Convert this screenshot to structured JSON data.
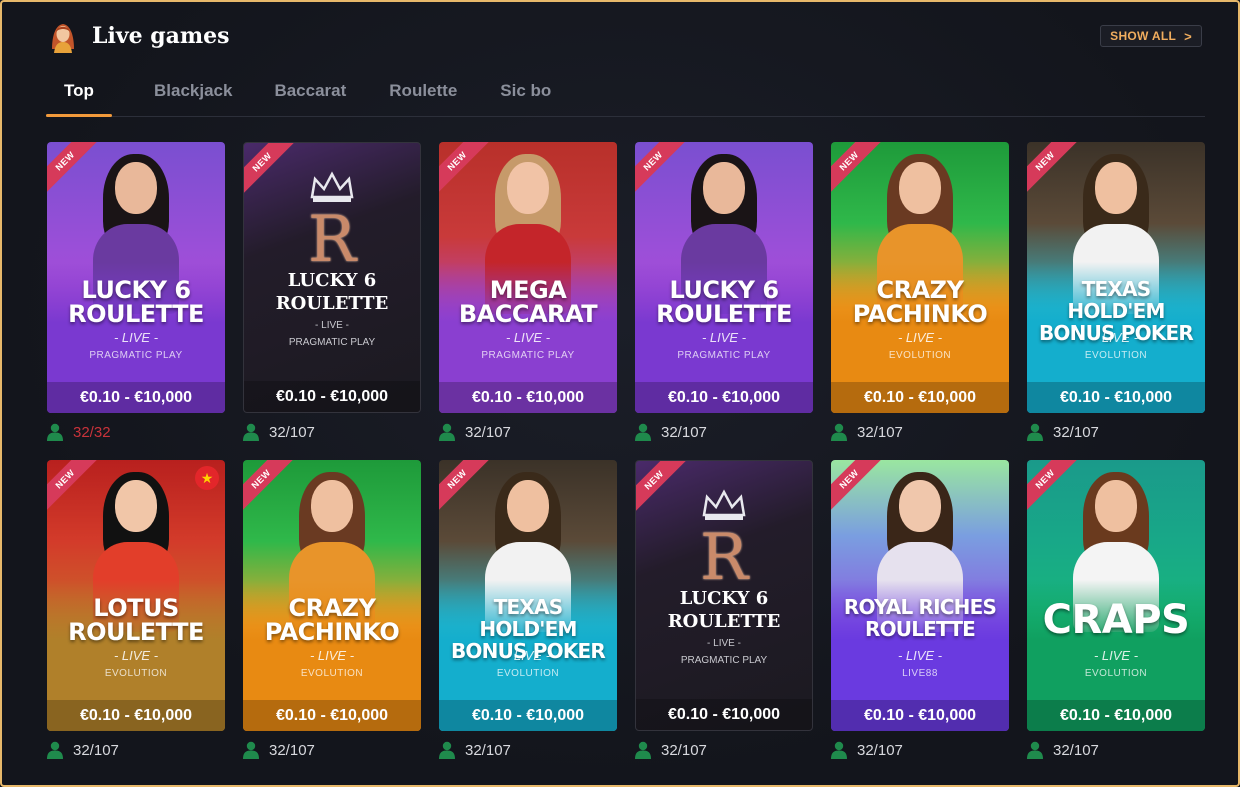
{
  "header": {
    "title": "Live games",
    "show_all_label": "SHOW ALL",
    "show_all_chevron": ">"
  },
  "tabs": [
    {
      "label": "Top",
      "active": true
    },
    {
      "label": "Blackjack",
      "active": false
    },
    {
      "label": "Baccarat",
      "active": false
    },
    {
      "label": "Roulette",
      "active": false
    },
    {
      "label": "Sic bo",
      "active": false
    }
  ],
  "badge_label": "NEW",
  "games": [
    {
      "title": "LUCKY 6 ROULETTE",
      "live": "- LIVE -",
      "provider": "PRAGMATIC PLAY",
      "limits": "€0.10 - €10,000",
      "players": "32/32",
      "theme": "purple",
      "full": true
    },
    {
      "title": "LUCKY 6 ROULETTE",
      "live": "- LIVE -",
      "provider": "PRAGMATIC PLAY",
      "limits": "€0.10 - €10,000",
      "players": "32/107",
      "theme": "dark"
    },
    {
      "title": "MEGA BACCARAT",
      "live": "- LIVE -",
      "provider": "PRAGMATIC PLAY",
      "limits": "€0.10 - €10,000",
      "players": "32/107",
      "theme": "red-purple"
    },
    {
      "title": "LUCKY 6 ROULETTE",
      "live": "- LIVE -",
      "provider": "PRAGMATIC PLAY",
      "limits": "€0.10 - €10,000",
      "players": "32/107",
      "theme": "purple"
    },
    {
      "title": "CRAZY PACHINKO",
      "live": "- LIVE -",
      "provider": "EVOLUTION",
      "limits": "€0.10 - €10,000",
      "players": "32/107",
      "theme": "green-orange"
    },
    {
      "title": "TEXAS HOLD'EM BONUS POKER",
      "live": "- LIVE -",
      "provider": "EVOLUTION",
      "limits": "€0.10 - €10,000",
      "players": "32/107",
      "theme": "cyan"
    },
    {
      "title": "LOTUS ROULETTE",
      "live": "- LIVE -",
      "provider": "EVOLUTION",
      "limits": "€0.10 - €10,000",
      "players": "32/107",
      "theme": "red-orange",
      "flag_icon": "star-flag-icon"
    },
    {
      "title": "CRAZY PACHINKO",
      "live": "- LIVE -",
      "provider": "EVOLUTION",
      "limits": "€0.10 - €10,000",
      "players": "32/107",
      "theme": "green-orange"
    },
    {
      "title": "TEXAS HOLD'EM BONUS POKER",
      "live": "- LIVE -",
      "provider": "EVOLUTION",
      "limits": "€0.10 - €10,000",
      "players": "32/107",
      "theme": "cyan"
    },
    {
      "title": "LUCKY 6 ROULETTE",
      "live": "- LIVE -",
      "provider": "PRAGMATIC PLAY",
      "limits": "€0.10 - €10,000",
      "players": "32/107",
      "theme": "dark"
    },
    {
      "title": "ROYAL RICHES ROULETTE",
      "live": "- LIVE -",
      "provider": "LIVE88",
      "limits": "€0.10 - €10,000",
      "players": "32/107",
      "theme": "violet"
    },
    {
      "title": "CRAPS",
      "live": "- LIVE -",
      "provider": "EVOLUTION",
      "limits": "€0.10 - €10,000",
      "players": "32/107",
      "theme": "teal-green"
    }
  ],
  "colors": {
    "accent": "#f29a3b",
    "border": "#e7b86a",
    "full_players": "#c9333b"
  }
}
